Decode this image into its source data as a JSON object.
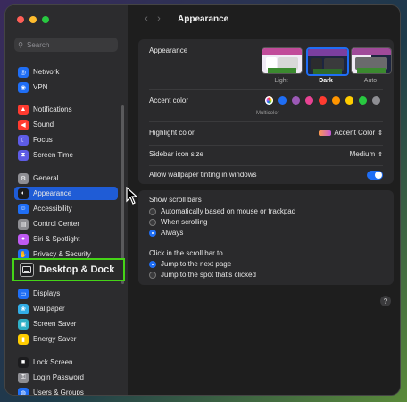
{
  "sidebar": {
    "search_placeholder": "Search",
    "items": [
      {
        "label": "Network",
        "icon": "globe-icon",
        "color": "#1f6ef5"
      },
      {
        "label": "VPN",
        "icon": "vpn-icon",
        "color": "#1f6ef5"
      },
      {
        "label": "Notifications",
        "icon": "bell-icon",
        "color": "#ff3b30"
      },
      {
        "label": "Sound",
        "icon": "speaker-icon",
        "color": "#ff3b30"
      },
      {
        "label": "Focus",
        "icon": "moon-icon",
        "color": "#5e5ce6"
      },
      {
        "label": "Screen Time",
        "icon": "hourglass-icon",
        "color": "#5e5ce6"
      },
      {
        "label": "General",
        "icon": "gear-icon",
        "color": "#8e8e93"
      },
      {
        "label": "Appearance",
        "icon": "appearance-icon",
        "color": "#1c1c1e"
      },
      {
        "label": "Accessibility",
        "icon": "accessibility-icon",
        "color": "#1f6ef5"
      },
      {
        "label": "Control Center",
        "icon": "control-center-icon",
        "color": "#8e8e93"
      },
      {
        "label": "Siri & Spotlight",
        "icon": "siri-icon",
        "color": "#bf5af2"
      },
      {
        "label": "Privacy & Security",
        "icon": "hand-icon",
        "color": "#1f6ef5"
      },
      {
        "label": "Displays",
        "icon": "display-icon",
        "color": "#1f6ef5"
      },
      {
        "label": "Wallpaper",
        "icon": "wallpaper-icon",
        "color": "#32ade6"
      },
      {
        "label": "Screen Saver",
        "icon": "screensaver-icon",
        "color": "#30b0c7"
      },
      {
        "label": "Energy Saver",
        "icon": "battery-icon",
        "color": "#ffcc00"
      },
      {
        "label": "Lock Screen",
        "icon": "lock-icon",
        "color": "#1c1c1e"
      },
      {
        "label": "Login Password",
        "icon": "key-icon",
        "color": "#8e8e93"
      },
      {
        "label": "Users & Groups",
        "icon": "users-icon",
        "color": "#1f6ef5"
      }
    ],
    "highlight_label": "Desktop & Dock"
  },
  "header": {
    "title": "Appearance"
  },
  "appearance": {
    "label": "Appearance",
    "options": [
      "Light",
      "Dark",
      "Auto"
    ],
    "selected": "Dark"
  },
  "accent": {
    "label": "Accent color",
    "colors": [
      "multicolor",
      "#1f6ef5",
      "#9b59b6",
      "#e84393",
      "#ff3b30",
      "#ff9500",
      "#ffcc00",
      "#28c840",
      "#8e8e93"
    ],
    "caption": "Multicolor"
  },
  "highlight": {
    "label": "Highlight color",
    "value": "Accent Color"
  },
  "sidebar_icon_size": {
    "label": "Sidebar icon size",
    "value": "Medium"
  },
  "wallpaper_tinting": {
    "label": "Allow wallpaper tinting in windows",
    "on": true
  },
  "scroll_bars": {
    "label": "Show scroll bars",
    "options": [
      "Automatically based on mouse or trackpad",
      "When scrolling",
      "Always"
    ],
    "selected": "Always"
  },
  "click_scroll": {
    "label": "Click in the scroll bar to",
    "options": [
      "Jump to the next page",
      "Jump to the spot that's clicked"
    ],
    "selected": "Jump to the next page"
  },
  "help": "?"
}
